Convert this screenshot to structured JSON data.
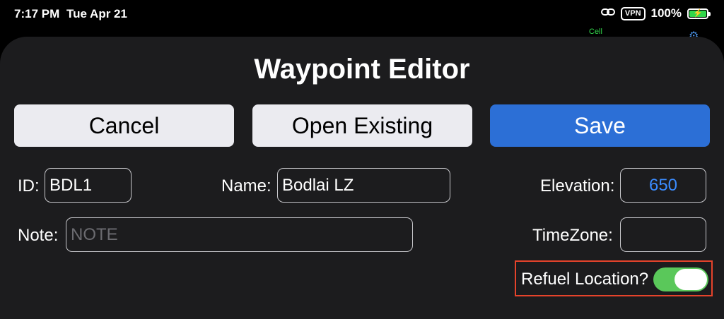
{
  "status_bar": {
    "time": "7:17 PM",
    "date": "Tue Apr 21",
    "vpn": "VPN",
    "battery": "100%",
    "battery_icon": "battery-charging-icon",
    "link_icon": "link-icon"
  },
  "background": {
    "cell_label": "Cell"
  },
  "editor": {
    "title": "Waypoint Editor",
    "buttons": {
      "cancel": "Cancel",
      "open_existing": "Open Existing",
      "save": "Save"
    },
    "fields": {
      "id": {
        "label": "ID:",
        "value": "BDL1"
      },
      "name": {
        "label": "Name:",
        "value": "Bodlai LZ"
      },
      "elevation": {
        "label": "Elevation:",
        "value": "650"
      },
      "note": {
        "label": "Note:",
        "value": "",
        "placeholder": "NOTE"
      },
      "timezone": {
        "label": "TimeZone:",
        "value": ""
      }
    },
    "refuel": {
      "label": "Refuel Location?",
      "on": true
    }
  },
  "colors": {
    "accent": "#2c6fd6",
    "toggle_on": "#5ac85a",
    "elevation_text": "#3b8cff",
    "highlight": "#e5432b",
    "sheet": "#1c1c1e"
  }
}
